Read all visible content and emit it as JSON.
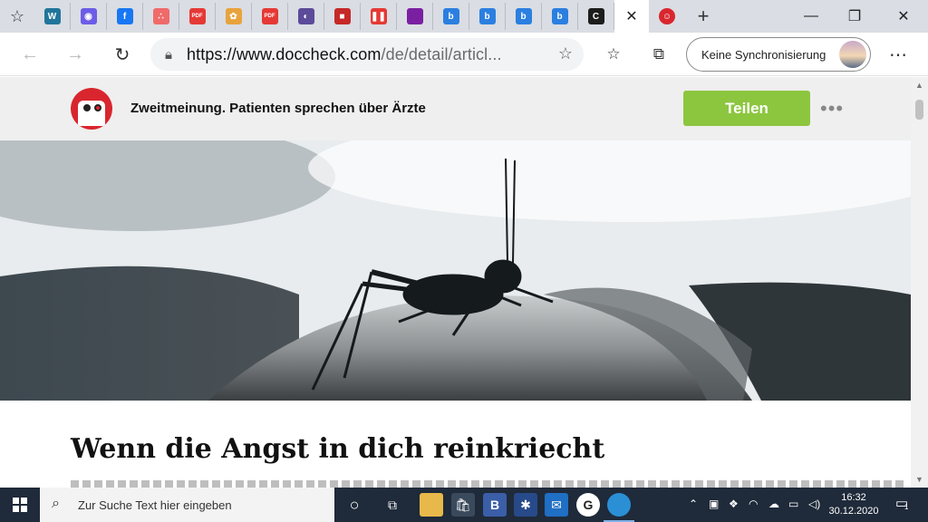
{
  "browser": {
    "tabs": [
      {
        "icon": "wordpress-icon",
        "color": "#21759b",
        "glyph": "W"
      },
      {
        "icon": "podcast-icon",
        "color": "#6c5ce7",
        "glyph": "◉"
      },
      {
        "icon": "facebook-icon",
        "color": "#1877f2",
        "glyph": "f"
      },
      {
        "icon": "asana-icon",
        "color": "#f06a6a",
        "glyph": "∴"
      },
      {
        "icon": "pdf-icon",
        "color": "#e53935",
        "glyph": "PDF"
      },
      {
        "icon": "badge-icon",
        "color": "#e8a33c",
        "glyph": "✿"
      },
      {
        "icon": "pdf-icon",
        "color": "#e53935",
        "glyph": "PDF"
      },
      {
        "icon": "colorful-logo-icon",
        "color": "#5b4b9a",
        "glyph": "◐"
      },
      {
        "icon": "red-square-icon",
        "color": "#c62828",
        "glyph": "■"
      },
      {
        "icon": "pause-icon",
        "color": "#e53935",
        "glyph": "❚❚"
      },
      {
        "icon": "purple-square-icon",
        "color": "#7b1fa2",
        "glyph": ""
      },
      {
        "icon": "bing-icon",
        "color": "#2b7fe0",
        "glyph": "b"
      },
      {
        "icon": "bing-icon",
        "color": "#2b7fe0",
        "glyph": "b"
      },
      {
        "icon": "bing-icon",
        "color": "#2b7fe0",
        "glyph": "b"
      },
      {
        "icon": "bing-icon",
        "color": "#2b7fe0",
        "glyph": "b"
      },
      {
        "icon": "c-icon",
        "color": "#1d1d1d",
        "glyph": "C"
      }
    ],
    "active_tab_close": "✕",
    "new_tab": "+",
    "url_host": "https://www.doccheck.com",
    "url_path": "/de/detail/articl...",
    "sync_label": "Keine Synchronisierung"
  },
  "page": {
    "site_title": "Zweitmeinung. Patienten sprechen über Ärzte",
    "share_label": "Teilen",
    "more_label": "•••",
    "article_title": "Wenn die Angst in dich reinkriecht"
  },
  "taskbar": {
    "search_placeholder": "Zur Suche Text hier eingeben",
    "time": "16:32",
    "date": "30.12.2020",
    "notifications_count": "1"
  },
  "colors": {
    "share_button": "#8cc63f",
    "logo_red": "#d9262e",
    "taskbar": "#1f2a3a"
  }
}
